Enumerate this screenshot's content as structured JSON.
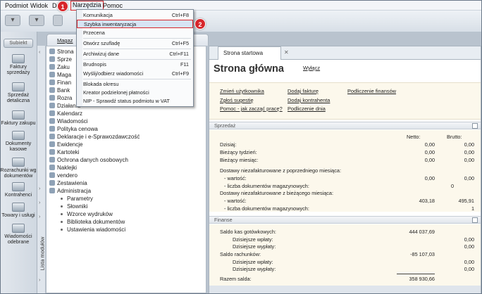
{
  "menu": {
    "items": [
      "Podmiot",
      "Widok",
      "D",
      "Narzędzia",
      "Pomoc"
    ]
  },
  "dropdown": {
    "items": [
      {
        "label": "Komunikacja",
        "shortcut": "Ctrl+F8"
      },
      {
        "label": "Szybka inwentaryzacja",
        "shortcut": ""
      },
      {
        "label": "Przecena",
        "shortcut": ""
      },
      {
        "label": "Otwórz szufladę",
        "shortcut": "Ctrl+F5"
      },
      {
        "label": "Archiwizuj dane",
        "shortcut": "Ctrl+F11"
      },
      {
        "label": "Brudnopis",
        "shortcut": "F11"
      },
      {
        "label": "Wyślij/odbierz wiadomości",
        "shortcut": "Ctrl+F9"
      },
      {
        "label": "Blokada okresu",
        "shortcut": ""
      },
      {
        "label": "Kreator podzielonej płatności",
        "shortcut": ""
      },
      {
        "label": "NIP - Sprawdź status podmiotu w VAT",
        "shortcut": ""
      }
    ]
  },
  "badges": [
    "1",
    "2"
  ],
  "leftnav": {
    "subiekt": "Subiekt",
    "items": [
      "Faktury sprzedaży",
      "Sprzedaż detaliczna",
      "Faktury zakupu",
      "Dokumenty kasowe",
      "Rozrachunki wg dokumentów",
      "Kontrahenci",
      "Towary i usługi",
      "Wiadomości odebrane"
    ]
  },
  "liststrip": {
    "label": "Lista modułów"
  },
  "tree": {
    "tab": "Magaz",
    "rows": [
      "Strona",
      "Sprze",
      "Zaku",
      "Maga",
      "Finan",
      "Bank",
      "Rozra",
      "Działania",
      "Kalendarz",
      "Wiadomości",
      "Polityka cenowa",
      "Deklaracje i e-Sprawozdawczość",
      "Ewidencje",
      "Kartoteki",
      "Ochrona danych osobowych",
      "Naklejki",
      "vendero",
      "Zestawienia",
      "Administracja"
    ],
    "admin_children": [
      "Parametry",
      "Słowniki",
      "Wzorce wydruków",
      "Biblioteka dokumentów",
      "Ustawienia wiadomości"
    ]
  },
  "main": {
    "tab": "Strona startowa Subiekta",
    "title": "Strona główna",
    "wyl": "Wyłącz",
    "links": {
      "c1": [
        "Zmień użytkownika",
        "Zgłoś sugestię",
        "Pomoc - jak zacząć pracę?"
      ],
      "c2": [
        "Dodaj fakturę",
        "Dodaj kontrahenta",
        "Podliczenie dnia"
      ],
      "c3": [
        "Podliczenie finansów"
      ]
    },
    "sprzedaz": {
      "header": "Sprzedaż",
      "col_netto": "Netto:",
      "col_brutto": "Brutto:",
      "rows": [
        {
          "label": "Dzisiaj:",
          "netto": "0,00",
          "brutto": "0,00"
        },
        {
          "label": "Bieżący tydzień:",
          "netto": "0,00",
          "brutto": "0,00"
        },
        {
          "label": "Bieżący miesiąc:",
          "netto": "0,00",
          "brutto": "0,00"
        }
      ],
      "prev_title": "Dostawy niezafakturowane z poprzedniego miesiąca:",
      "prev_wartosc_label": "- wartość:",
      "prev_wartosc_n": "0,00",
      "prev_wartosc_b": "0,00",
      "prev_liczba_label": "- liczba dokumentów magazynowych:",
      "prev_liczba": "0",
      "cur_title": "Dostawy niezafakturowane z bieżącego miesiąca:",
      "cur_wartosc_label": "- wartość:",
      "cur_wartosc_n": "403,18",
      "cur_wartosc_b": "495,91",
      "cur_liczba_label": "- liczba dokumentów magazynowych:",
      "cur_liczba": "1"
    },
    "finanse": {
      "header": "Finanse",
      "saldo_kas_label": "Saldo kas gotówkowych:",
      "saldo_kas": "444 037,69",
      "kas_wplaty_label": "Dzisiejsze wpłaty:",
      "kas_wplaty": "0,00",
      "kas_wyplaty_label": "Dzisiejsze wypłaty:",
      "kas_wyplaty": "0,00",
      "saldo_rach_label": "Saldo rachunków:",
      "saldo_rach": "-85 107,03",
      "rach_wplaty_label": "Dzisiejsze wpłaty:",
      "rach_wplaty": "0,00",
      "rach_wyplaty_label": "Dzisiejsze wypłaty:",
      "rach_wyplaty": "0,00",
      "razem_label": "Razem salda:",
      "razem": "358 930,66"
    }
  }
}
